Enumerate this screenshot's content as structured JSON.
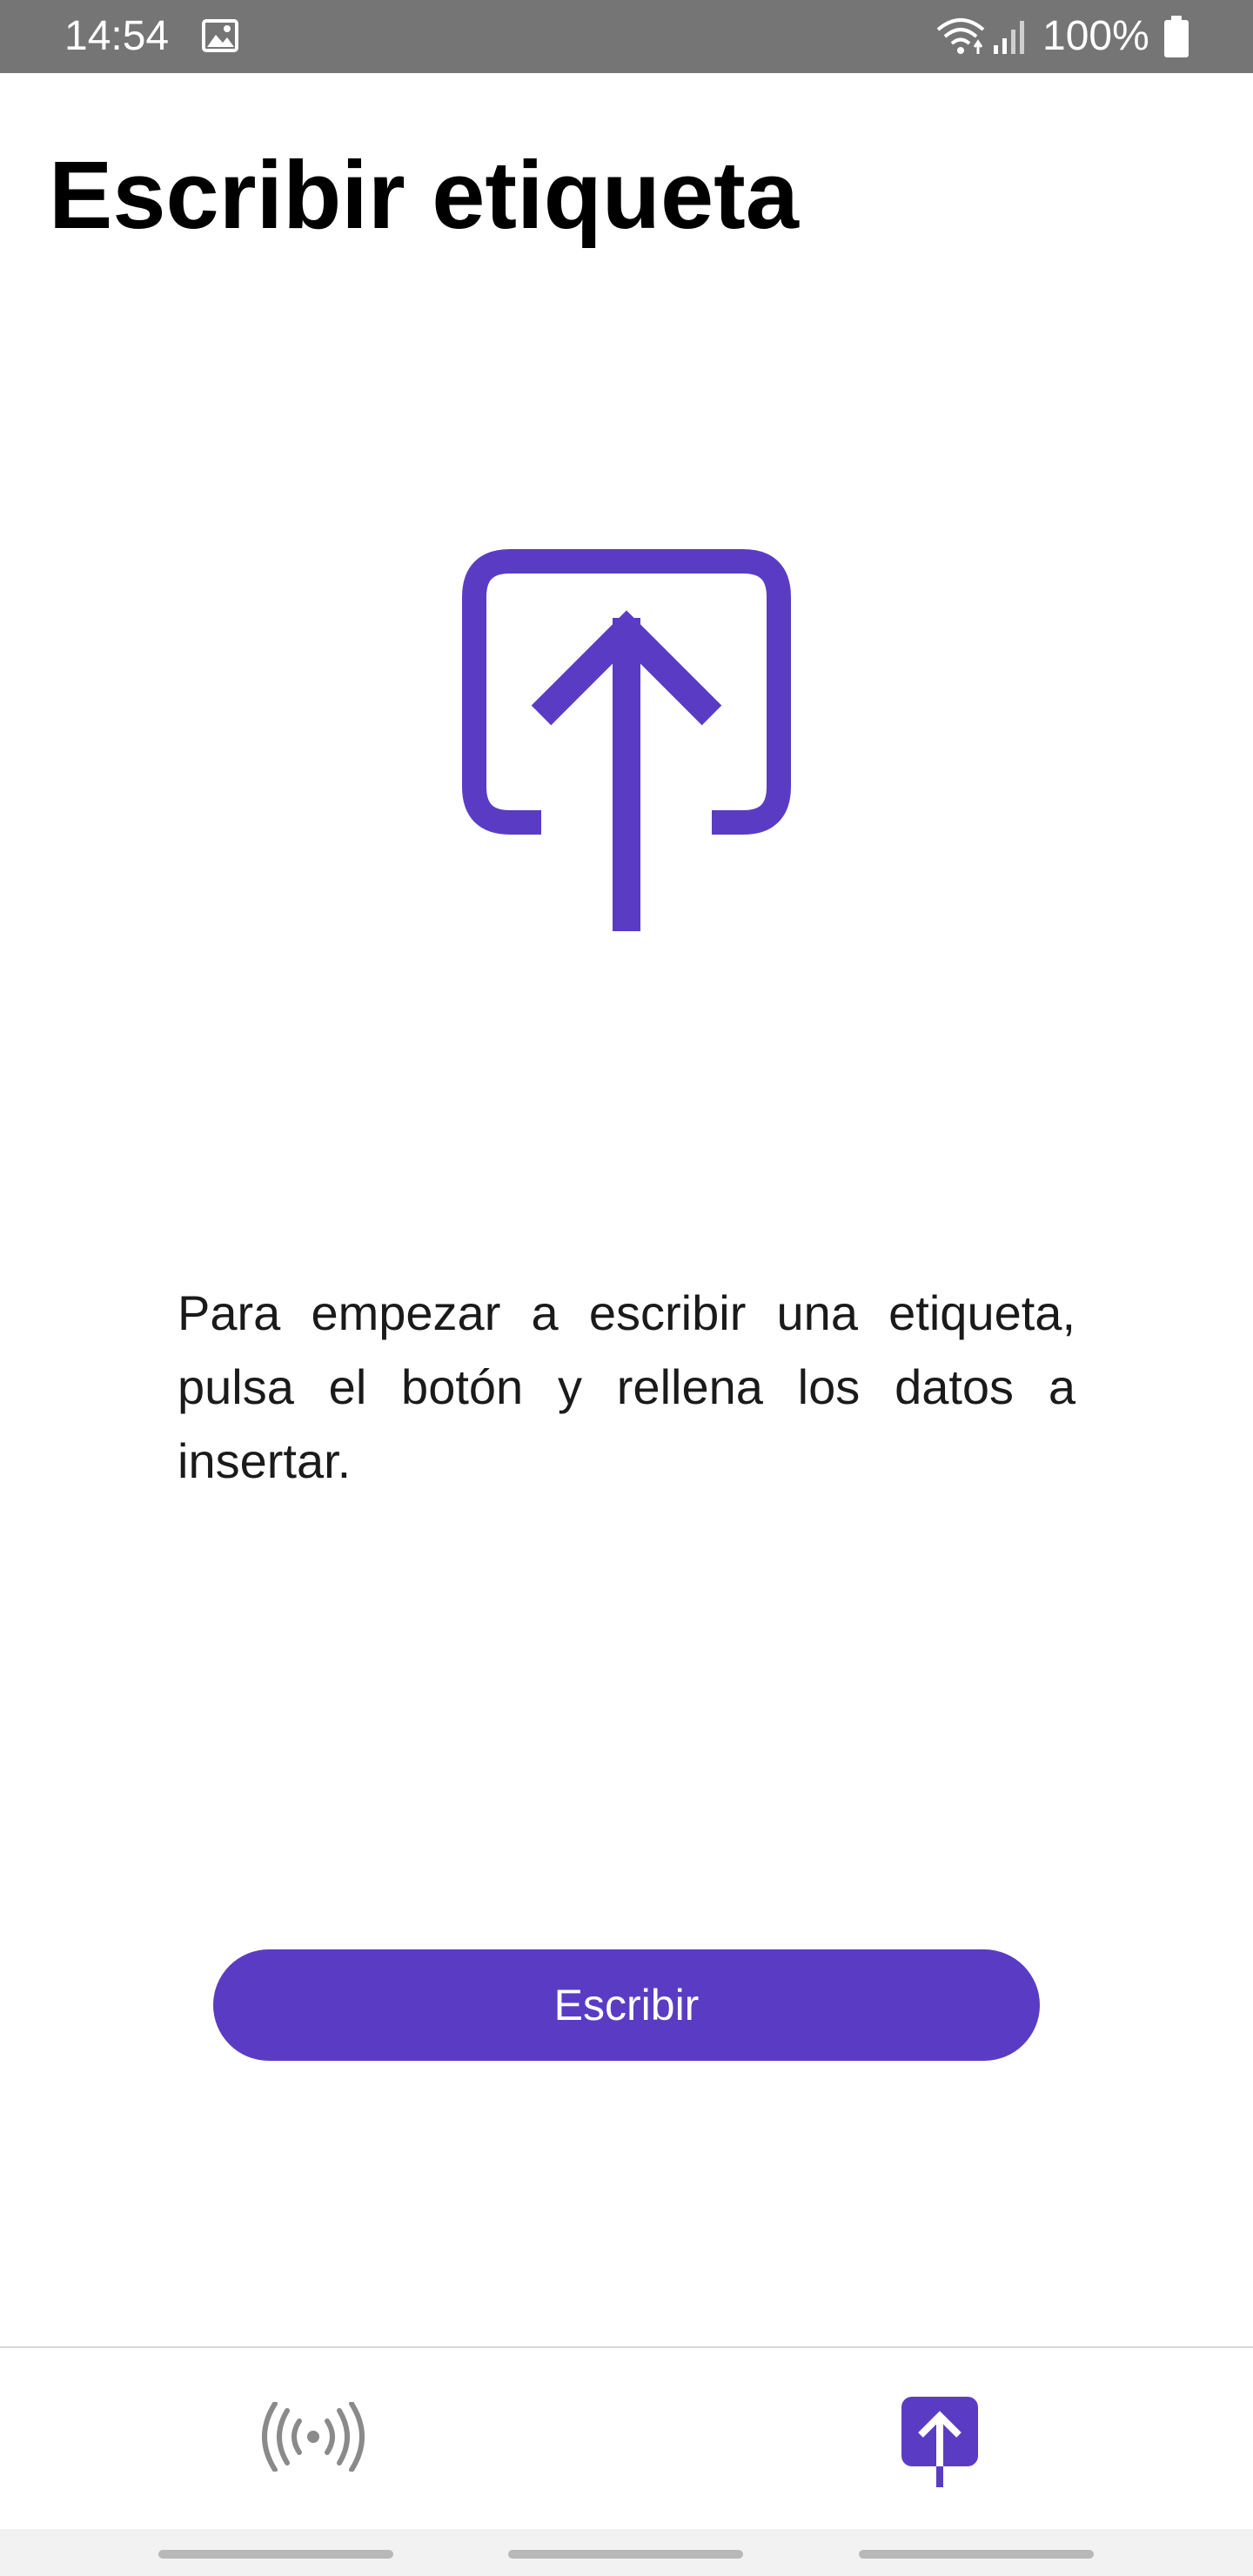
{
  "status_bar": {
    "time": "14:54",
    "battery_percent": "100%",
    "icons": [
      "gallery-icon",
      "wifi-icon",
      "signal-icon",
      "battery-icon"
    ]
  },
  "header": {
    "title": "Escribir etiqueta"
  },
  "main": {
    "hero_icon": "upload-icon",
    "description": "Para empezar a escribir una etiqueta, pulsa el botón y rellena los datos a insertar.",
    "write_button_label": "Escribir"
  },
  "bottom_nav": {
    "items": [
      {
        "icon": "nfc-read-icon",
        "selected": false
      },
      {
        "icon": "write-tag-icon",
        "selected": true
      }
    ]
  },
  "colors": {
    "accent": "#5a3cc4",
    "status_bar": "#757575",
    "inactive_icon": "#8a8a8a",
    "text": "#000000",
    "background": "#ffffff"
  }
}
